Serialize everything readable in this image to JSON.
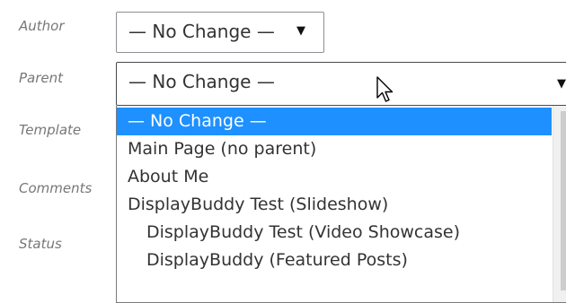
{
  "fields": {
    "author_label": "Author",
    "parent_label": "Parent",
    "template_label": "Template",
    "comments_label": "Comments",
    "status_label": "Status"
  },
  "author_select": {
    "value": "— No Change —",
    "arrow": "▼"
  },
  "parent_select": {
    "value": "— No Change —",
    "arrow": "▼",
    "options": [
      {
        "label": "— No Change —",
        "selected": true
      },
      {
        "label": "Main Page (no parent)"
      },
      {
        "label": "About Me"
      },
      {
        "label": "DisplayBuddy Test (Slideshow)"
      },
      {
        "label": "DisplayBuddy Test (Video Showcase)"
      },
      {
        "label": "DisplayBuddy (Featured Posts)"
      }
    ]
  },
  "colors": {
    "selection": "#1e90ff",
    "label_text": "#777777",
    "text": "#333333"
  }
}
